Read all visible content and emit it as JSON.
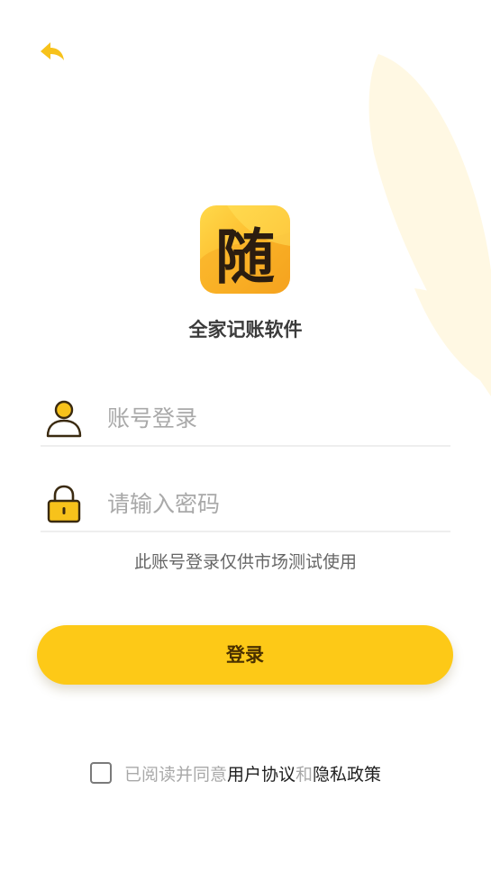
{
  "app": {
    "name": "全家记账软件",
    "logo_char": "随"
  },
  "form": {
    "account_placeholder": "账号登录",
    "password_placeholder": "请输入密码"
  },
  "notice": "此账号登录仅供市场测试使用",
  "login_button": "登录",
  "agreement": {
    "prefix": "已阅读并同意",
    "user_agreement": "用户协议",
    "conjunction": "和",
    "privacy_policy": "隐私政策"
  },
  "icons": {
    "back": "back-arrow-icon",
    "user": "user-icon",
    "lock": "lock-icon",
    "checkbox": "checkbox-unchecked"
  },
  "colors": {
    "accent": "#fdc917",
    "text": "#3b3b3b",
    "placeholder": "#a9a9a9",
    "link": "#1f1f1f"
  }
}
